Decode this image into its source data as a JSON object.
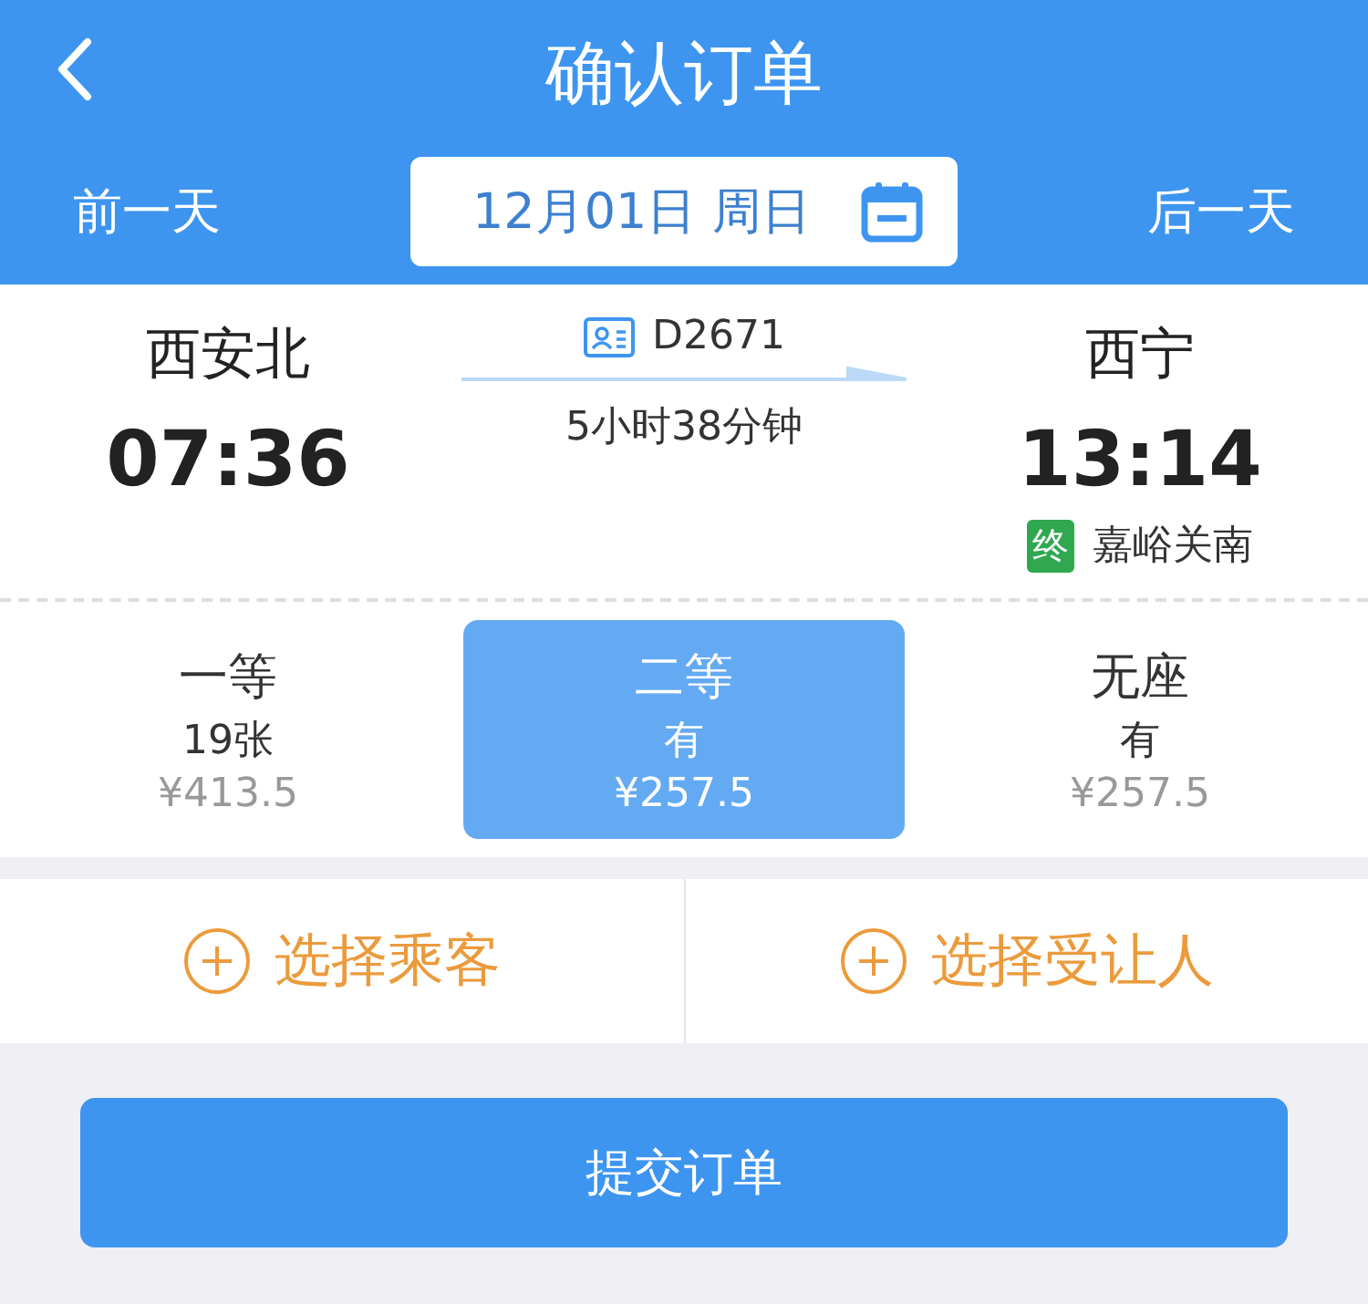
{
  "header": {
    "title": "确认订单"
  },
  "date_bar": {
    "prev": "前一天",
    "date": "12月01日 周日",
    "next": "后一天"
  },
  "train": {
    "from_station": "西安北",
    "depart_time": "07:36",
    "number": "D2671",
    "duration": "5小时38分钟",
    "to_station": "西宁",
    "arrive_time": "13:14",
    "terminal_badge": "终",
    "terminal_station": "嘉峪关南"
  },
  "seats": [
    {
      "class": "一等",
      "availability": "19张",
      "price": "¥413.5",
      "selected": false
    },
    {
      "class": "二等",
      "availability": "有",
      "price": "¥257.5",
      "selected": true
    },
    {
      "class": "无座",
      "availability": "有",
      "price": "¥257.5",
      "selected": false
    }
  ],
  "actions": [
    "选择乘客",
    "选择受让人"
  ],
  "submit_button": "提交订单"
}
